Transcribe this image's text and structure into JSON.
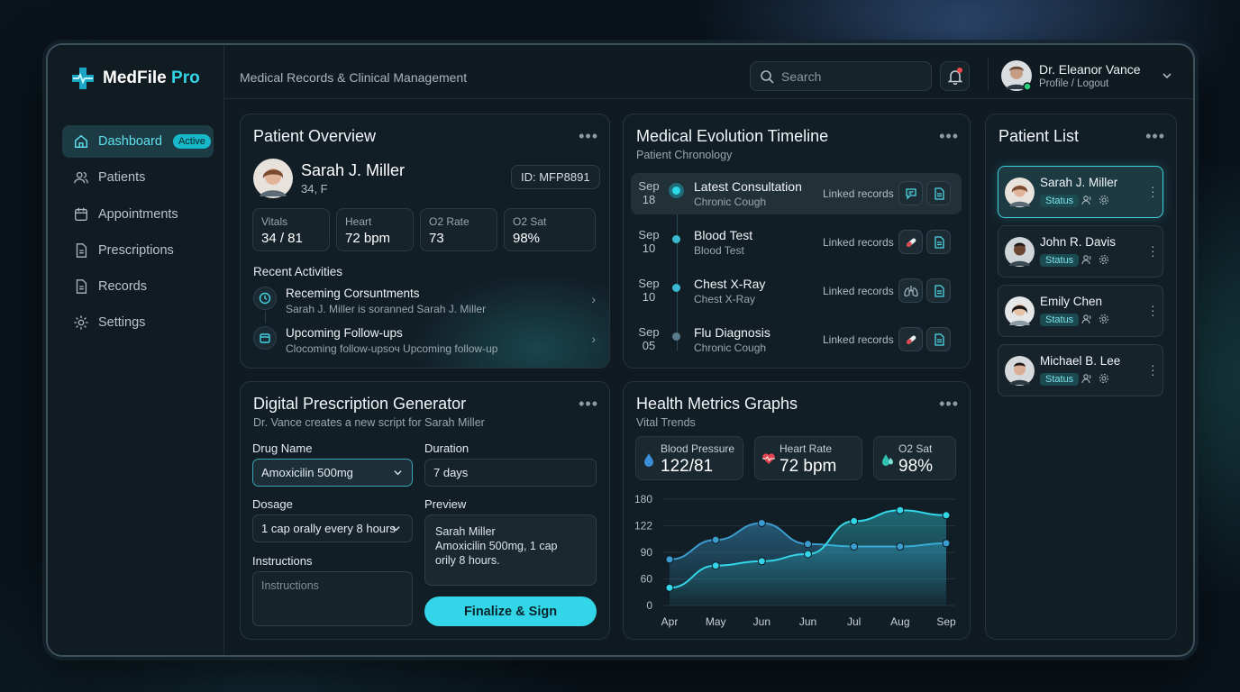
{
  "app": {
    "name_main": "MedFile",
    "name_accent": "Pro"
  },
  "topbar": {
    "breadcrumb": "Medical Records & Clinical Management",
    "search_placeholder": "Search",
    "user_name": "Dr. Eleanor Vance",
    "user_sub": "Profile / Logout"
  },
  "sidebar": {
    "items": [
      {
        "label": "Dashboard",
        "icon": "home-icon",
        "active": true,
        "badge": "Active"
      },
      {
        "label": "Patients",
        "icon": "users-icon"
      },
      {
        "label": "Appointments",
        "icon": "calendar-icon"
      },
      {
        "label": "Prescriptions",
        "icon": "document-icon"
      },
      {
        "label": "Records",
        "icon": "document-icon"
      },
      {
        "label": "Settings",
        "icon": "gear-icon"
      }
    ]
  },
  "overview": {
    "title": "Patient Overview",
    "patient_name": "Sarah J. Miller",
    "patient_meta": "34, F",
    "patient_id": "ID: MFP8891",
    "vitals": [
      {
        "label": "Vitals",
        "value": "34 / 81"
      },
      {
        "label": "Heart",
        "value": "72 bpm"
      },
      {
        "label": "O2 Rate",
        "value": "73"
      },
      {
        "label": "O2 Sat",
        "value": "98%"
      }
    ],
    "recent_title": "Recent Activities",
    "activities": [
      {
        "title": "Receming Corsuntments",
        "sub": "Sarah J. Miller is soranned Sarah J. Miller",
        "icon": "clock-icon"
      },
      {
        "title": "Upcoming Follow-ups",
        "sub": "Clocoming follow-upsоч Upcoming follow-up",
        "icon": "calendar-icon"
      }
    ]
  },
  "timeline": {
    "title": "Medical Evolution Timeline",
    "subtitle": "Patient Chronology",
    "link_label": "Linked records",
    "events": [
      {
        "month": "Sep",
        "day": "18",
        "title": "Latest Consultation",
        "sub": "Chronic Cough",
        "icon": "chat-icon",
        "highlight": true
      },
      {
        "month": "Sep",
        "day": "10",
        "title": "Blood Test",
        "sub": "Blood Test",
        "icon": "pill-icon"
      },
      {
        "month": "Sep",
        "day": "10",
        "title": "Chest X-Ray",
        "sub": "Chest X-Ray",
        "icon": "lungs-icon"
      },
      {
        "month": "Sep",
        "day": "05",
        "title": "Flu Diagnosis",
        "sub": "Chronic Cough",
        "icon": "pill-icon"
      }
    ]
  },
  "prescription": {
    "title": "Digital Prescription Generator",
    "subtitle": "Dr. Vance creates a new script for Sarah Miller",
    "drug_label": "Drug Name",
    "drug_value": "Amoxicilin 500mg",
    "duration_label": "Duration",
    "duration_value": "7 days",
    "dosage_label": "Dosage",
    "dosage_value": "1 cap orally every 8 hours",
    "preview_label": "Preview",
    "preview_line1": "Sarah Miller",
    "preview_line2": "Amoxicilin 500mg,  1 cap",
    "preview_line3": "orily 8 hours.",
    "instructions_label": "Instructions",
    "instructions_placeholder": "Instructions",
    "finalize_label": "Finalize & Sign"
  },
  "metrics": {
    "title": "Health Metrics Graphs",
    "subtitle": "Vital Trends",
    "cards": [
      {
        "label": "Blood Pressure",
        "value": "122/81",
        "icon": "droplet-icon"
      },
      {
        "label": "Heart Rate",
        "value": "72 bpm",
        "icon": "heart-pulse-icon"
      },
      {
        "label": "O2 Sat",
        "value": "98%",
        "icon": "droplets-icon"
      }
    ]
  },
  "chart_data": {
    "type": "area",
    "categories": [
      "Apr",
      "May",
      "Jun",
      "Jun",
      "Jul",
      "Aug",
      "Sep"
    ],
    "y_ticks": [
      0,
      60,
      90,
      122,
      180
    ],
    "ylim": [
      0,
      180
    ],
    "y_scale": "non-uniform (tick labels evenly spaced)",
    "series": [
      {
        "values": [
          82,
          105,
          128,
          100,
          97,
          97,
          101
        ],
        "color": "#3b9cd0"
      },
      {
        "values": [
          40,
          75,
          80,
          88,
          132,
          156,
          145
        ],
        "color": "#33d6e8"
      }
    ],
    "grid": true,
    "legend": "none"
  },
  "patient_list": {
    "title": "Patient List",
    "status_label": "Status",
    "patients": [
      {
        "name": "Sarah J. Miller",
        "selected": true
      },
      {
        "name": "John R. Davis"
      },
      {
        "name": "Emily Chen"
      },
      {
        "name": "Michael B. Lee"
      }
    ]
  }
}
